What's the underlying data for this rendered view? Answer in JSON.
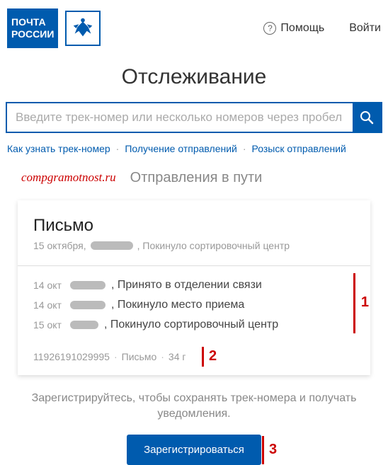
{
  "header": {
    "logo_line1": "ПОЧТА",
    "logo_line2": "РОССИИ",
    "help_label": "Помощь",
    "login_label": "Войти"
  },
  "page_title": "Отслеживание",
  "search": {
    "placeholder": "Введите трек-номер или несколько номеров через пробел"
  },
  "nav": {
    "link1": "Как узнать трек-номер",
    "link2": "Получение отправлений",
    "link3": "Розыск отправлений"
  },
  "watermark": "compgramotnost.ru",
  "section_title": "Отправления в пути",
  "card": {
    "title": "Письмо",
    "subtitle_date": "15 октября,",
    "subtitle_status": ", Покинуло сортировочный центр",
    "events": [
      {
        "date": "14 окт",
        "text": ", Принято в отделении связи"
      },
      {
        "date": "14 окт",
        "text": ", Покинуло место приема"
      },
      {
        "date": "15 окт",
        "text": ", Покинуло сортировочный центр"
      }
    ],
    "meta": {
      "track_number": "11926191029995",
      "type": "Письмо",
      "weight": "34 г"
    }
  },
  "register": {
    "text": "Зарегистрируйтесь, чтобы сохранять трек-номера и получать уведомления.",
    "button": "Зарегистрироваться"
  },
  "annotations": {
    "n1": "1",
    "n2": "2",
    "n3": "3"
  }
}
